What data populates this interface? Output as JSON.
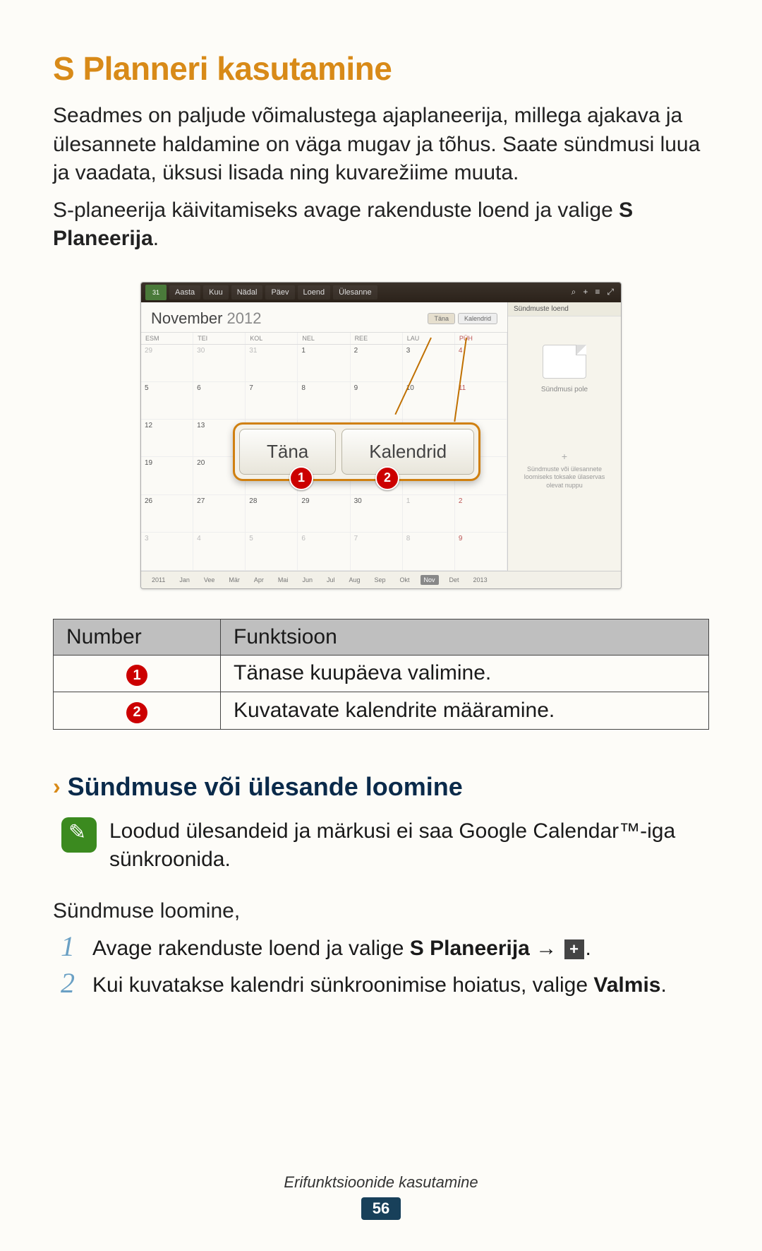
{
  "title": "S Planneri kasutamine",
  "intro_para_1": "Seadmes on paljude võimalustega ajaplaneerija, millega ajakava ja ülesannete haldamine on väga mugav ja tõhus. Saate sündmusi luua ja vaadata, üksusi lisada ning kuvarežiime muuta.",
  "intro_para_2_a": "S-planeerija käivitamiseks avage rakenduste loend ja valige ",
  "intro_para_2_b": "S Planeerija",
  "intro_para_2_c": ".",
  "screenshot": {
    "tabs": [
      "Aasta",
      "Kuu",
      "Nädal",
      "Päev",
      "Loend",
      "Ülesanne"
    ],
    "month_name": "November",
    "month_year": "2012",
    "top_buttons": [
      "Täna",
      "Kalendrid"
    ],
    "dow": [
      "ESM",
      "TEI",
      "KOL",
      "NEL",
      "REE",
      "LAU",
      "PÜH"
    ],
    "popup": {
      "btn1": "Täna",
      "btn2": "Kalendrid"
    },
    "side_title": "Sündmuste loend",
    "side_empty": "Sündmusi pole",
    "side_hint": "Sündmuste või ülesannete loomiseks toksake ülaservas olevat nuppu",
    "bottom_year_left": "2011",
    "bottom_year_right": "2013",
    "bottom_months": [
      "Jan",
      "Vee",
      "Mär",
      "Apr",
      "Mai",
      "Jun",
      "Jul",
      "Aug",
      "Sep",
      "Okt",
      "Nov",
      "Det"
    ],
    "grid_rows": [
      [
        "29",
        "30",
        "31",
        "1",
        "2",
        "3",
        "4"
      ],
      [
        "5",
        "6",
        "7",
        "8",
        "9",
        "10",
        "11"
      ],
      [
        "12",
        "13",
        "",
        "",
        "",
        "",
        ""
      ],
      [
        "19",
        "20",
        "",
        "",
        "",
        "",
        ""
      ],
      [
        "26",
        "27",
        "28",
        "29",
        "30",
        "1",
        "2"
      ],
      [
        "3",
        "4",
        "5",
        "6",
        "7",
        "8",
        "9"
      ]
    ]
  },
  "table": {
    "headers": [
      "Number",
      "Funktsioon"
    ],
    "rows": [
      {
        "num": "1",
        "desc": "Tänase kuupäeva valimine."
      },
      {
        "num": "2",
        "desc": "Kuvatavate kalendrite määramine."
      }
    ]
  },
  "subheading": "Sündmuse või ülesande loomine",
  "note": "Loodud ülesandeid ja märkusi ei saa Google Calendar™-iga sünkroonida.",
  "steps_intro": "Sündmuse loomine,",
  "steps": [
    {
      "num": "1",
      "text_a": "Avage rakenduste loend ja valige ",
      "bold": "S Planeerija",
      "text_b": " → ",
      "has_plus": true,
      "text_c": "."
    },
    {
      "num": "2",
      "text_a": "Kui kuvatakse kalendri sünkroonimise hoiatus, valige ",
      "bold": "Valmis",
      "text_b": ".",
      "has_plus": false,
      "text_c": ""
    }
  ],
  "footer_label": "Erifunktsioonide kasutamine",
  "page_number": "56"
}
